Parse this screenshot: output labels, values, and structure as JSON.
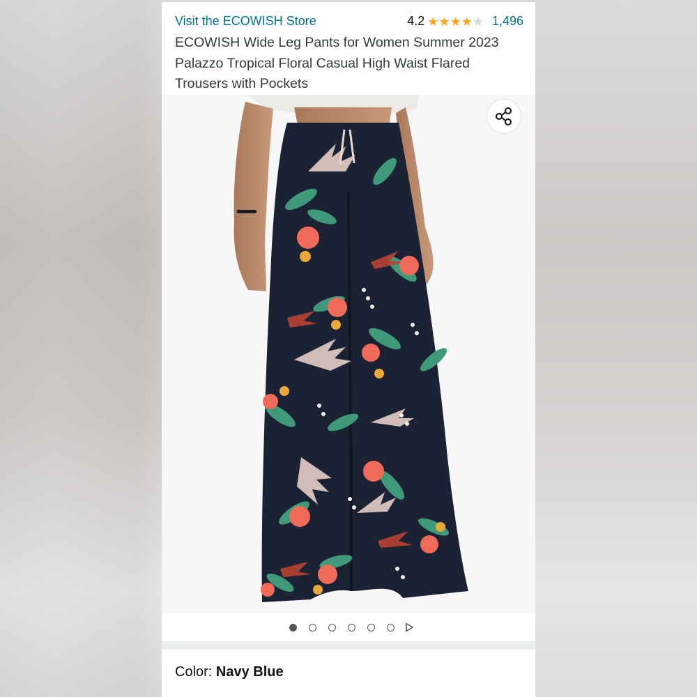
{
  "store": {
    "link_text": "Visit the ECOWISH Store"
  },
  "rating": {
    "value": "4.2",
    "stars": 4.2,
    "review_count": "1,496"
  },
  "product": {
    "title": "ECOWISH Wide Leg Pants for Women Summer 2023 Palazzo Tropical Floral Casual High Waist Flared Trousers with Pockets"
  },
  "gallery": {
    "total_images": 6,
    "active_index": 0,
    "image_subject": "Navy blue wide leg palazzo pants with tropical floral print worn by model"
  },
  "share": {
    "icon": "share-icon"
  },
  "variant": {
    "label": "Color:",
    "value": "Navy Blue"
  },
  "colors": {
    "link": "#007185",
    "star": "#ffa41c",
    "pants_base": "#1b2233"
  }
}
